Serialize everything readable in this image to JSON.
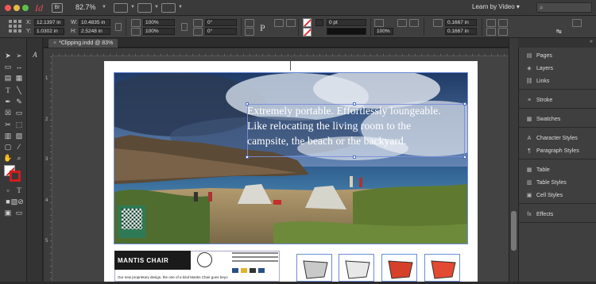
{
  "appbar": {
    "zoom": "82.7%",
    "workspace": "Learn by Video",
    "workspace_caret": "▾",
    "bridge_label": "Br"
  },
  "controlbar": {
    "x_label": "X:",
    "y_label": "Y:",
    "w_label": "W:",
    "h_label": "H:",
    "x_value": "12.1397 in",
    "y_value": "1.0302 in",
    "w_value": "10.4835 in",
    "h_value": "2.5248 in",
    "scale_x": "100%",
    "scale_y": "100%",
    "rotate": "0°",
    "shear": "0°",
    "stroke_pct": "100%",
    "stroke_weight": "0 pt",
    "ref_x": "0.1667 in",
    "ref_y": "0.1667 in",
    "frame_pct": "100%"
  },
  "document": {
    "tab_label": "*Clipping.indd @ 83%",
    "close": "×",
    "headline_line1": "Extremely portable. Effortlessly loungeable.",
    "headline_line2": "Like relocating the living room to the",
    "headline_line3": "campsite, the beach or the backyard.",
    "product_title": "MANTIS CHAIR",
    "product_copy": "Our new proprietary design, the one of a kind Mantis Chair goes beyo"
  },
  "rulers": {
    "v1": "1",
    "v2": "2",
    "v3": "3",
    "v4": "4",
    "v5": "5"
  },
  "panels": [
    {
      "icon": "pages-icon",
      "glyph": "▤",
      "label": "Pages"
    },
    {
      "icon": "layers-icon",
      "glyph": "◈",
      "label": "Layers"
    },
    {
      "icon": "links-icon",
      "glyph": "⛓",
      "label": "Links"
    },
    {
      "icon": "stroke-icon",
      "glyph": "≡",
      "label": "Stroke"
    },
    {
      "icon": "swatches-icon",
      "glyph": "▦",
      "label": "Swatches"
    },
    {
      "icon": "character-styles-icon",
      "glyph": "A",
      "label": "Character Styles"
    },
    {
      "icon": "paragraph-styles-icon",
      "glyph": "¶",
      "label": "Paragraph Styles"
    },
    {
      "icon": "table-icon",
      "glyph": "▦",
      "label": "Table"
    },
    {
      "icon": "table-styles-icon",
      "glyph": "▥",
      "label": "Table Styles"
    },
    {
      "icon": "cell-styles-icon",
      "glyph": "▣",
      "label": "Cell Styles"
    },
    {
      "icon": "effects-icon",
      "glyph": "fx",
      "label": "Effects"
    }
  ],
  "colors": {
    "accent_red": "#e34b57",
    "selection_blue": "#6b8cd6",
    "panel_bg": "#3f3f3f"
  }
}
